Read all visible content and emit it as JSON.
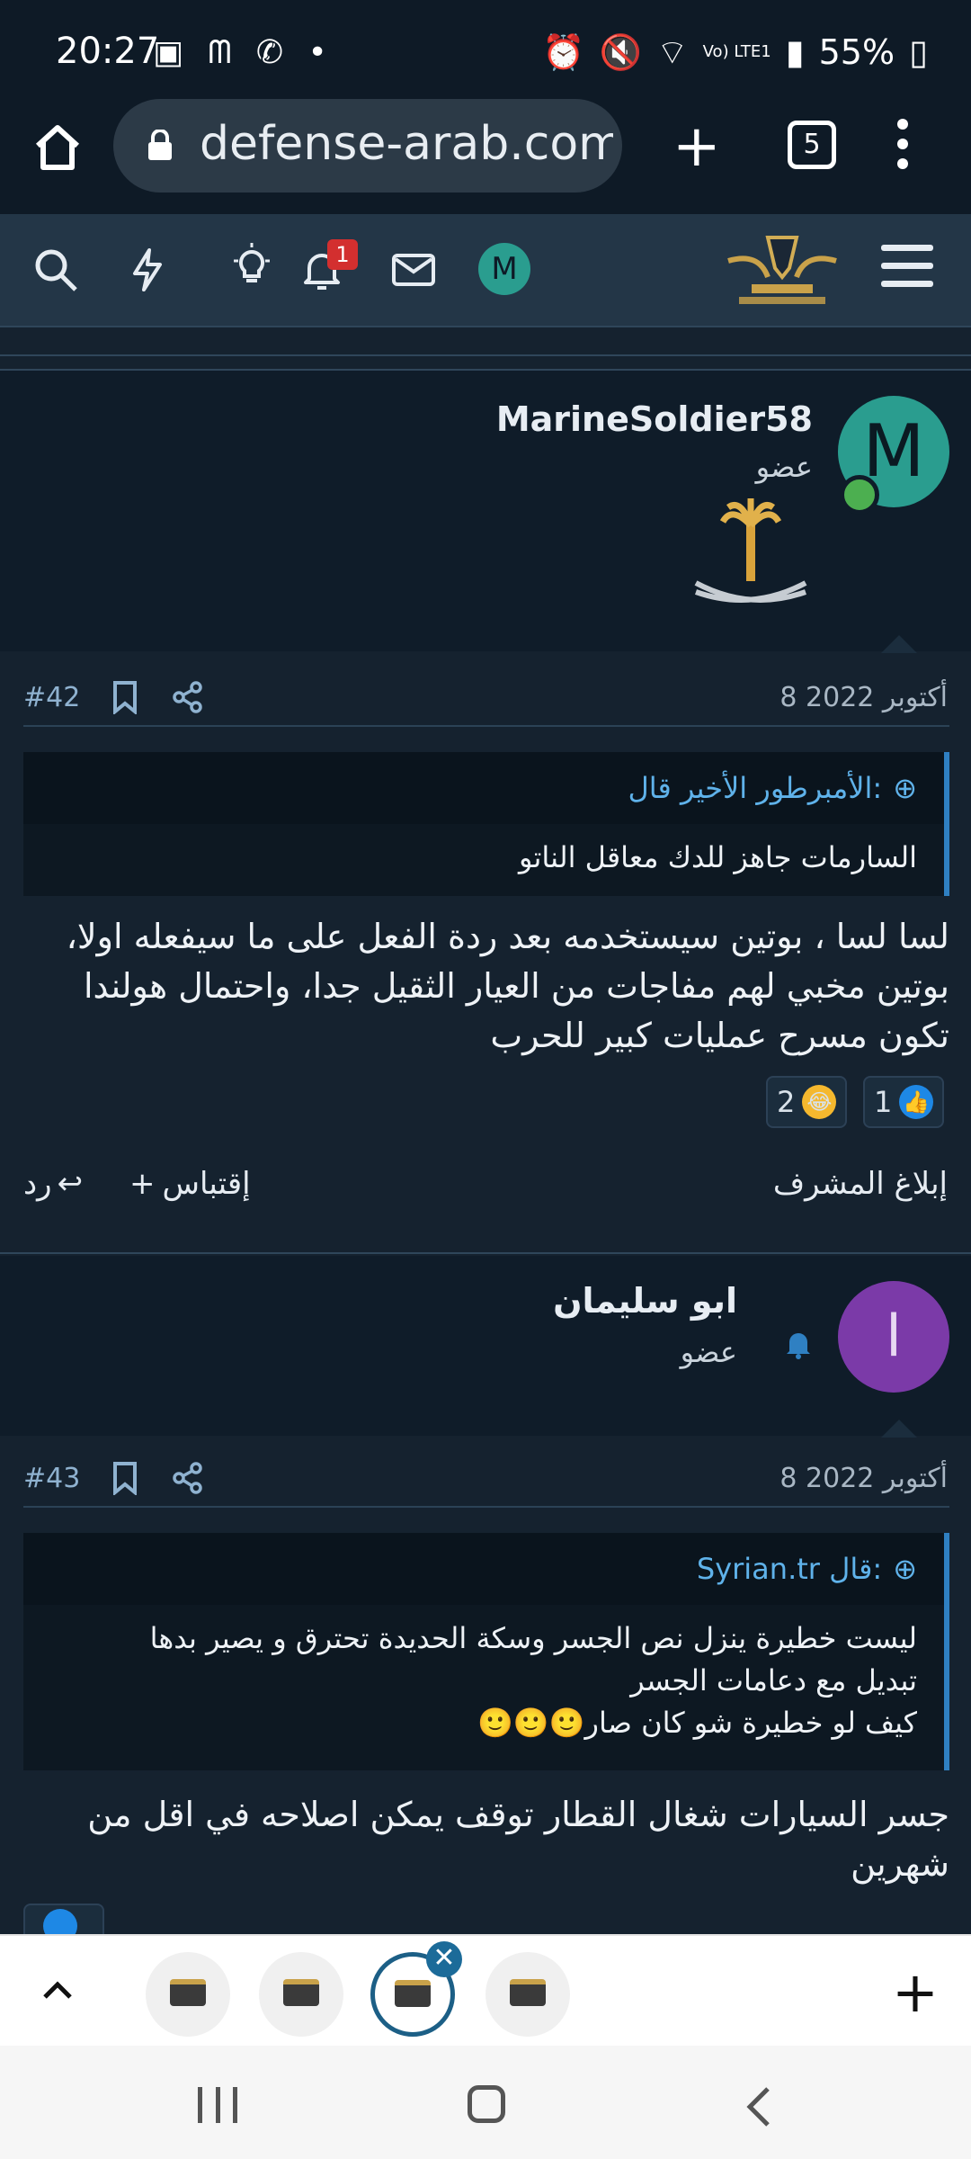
{
  "status_bar": {
    "time": "20:27",
    "battery": "55%",
    "network": "Vo) LTE1"
  },
  "browser": {
    "url": "defense-arab.com/",
    "tab_count": "5"
  },
  "site_nav": {
    "notification_count": "1",
    "avatar_letter": "M"
  },
  "posts": [
    {
      "username": "MarineSoldier58",
      "role": "عضو",
      "avatar_letter": "M",
      "avatar_color": "#2a9d8f",
      "date": "8 أكتوبر 2022",
      "number": "#42",
      "quote_author": "الأمبرطور الأخير قال:",
      "quote_text": "السارمات جاهز للدك معاقل الناتو",
      "body": "لسا لسا ، بوتين سيستخدمه بعد ردة الفعل على ما سيفعله اولا، بوتين مخبي لهم مفاجات من العيار الثقيل جدا، واحتمال هولندا تكون مسرح عمليات كبير للحرب",
      "reactions": [
        {
          "icon": "like-icon",
          "count": "1"
        },
        {
          "icon": "laugh-icon",
          "count": "2"
        }
      ],
      "report_label": "إبلاغ المشرف",
      "quote_label": "إقتباس",
      "reply_label": "رد"
    },
    {
      "username": "ابو سليمان",
      "role": "عضو",
      "avatar_letter": "ا",
      "avatar_color": "#7b3aa8",
      "date": "8 أكتوبر 2022",
      "number": "#43",
      "quote_author": "Syrian.tr قال:",
      "quote_lines": [
        "ليست خطيرة ينزل نص الجسر وسكة الحديدة تحترق و يصير بدها",
        "تبديل مع دعامات الجسر",
        "كيف لو خطيرة شو كان صار🙂🙂🙂"
      ],
      "body": "جسر السيارات شغال القطار توقف يمكن اصلاحه في اقل من شهرين"
    }
  ],
  "colors": {
    "accent": "#2f80c2",
    "background": "#15222f",
    "header": "#233647"
  }
}
